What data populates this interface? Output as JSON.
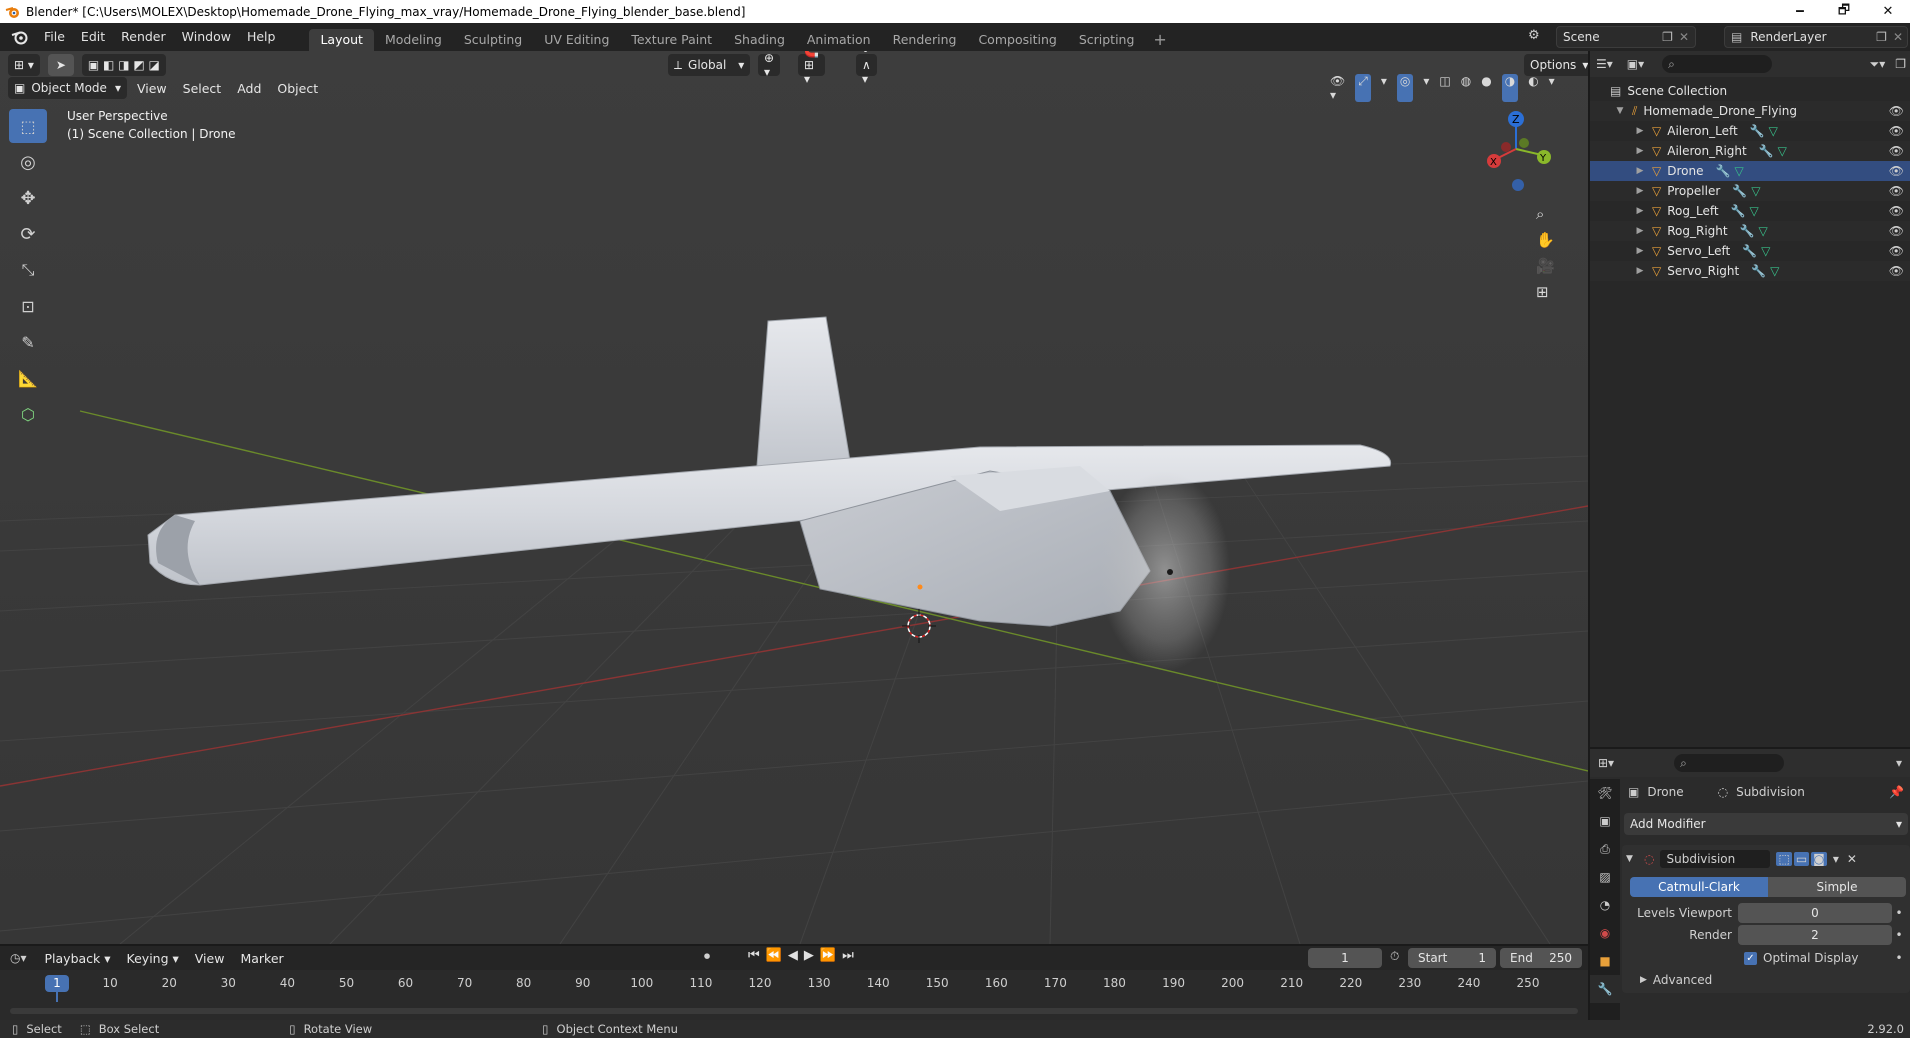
{
  "window": {
    "title": "Blender* [C:\\Users\\MOLEX\\Desktop\\Homemade_Drone_Flying_max_vray/Homemade_Drone_Flying_blender_base.blend]",
    "minimize": "🗕",
    "maximize": "🗗",
    "close": "✕"
  },
  "menu": [
    "File",
    "Edit",
    "Render",
    "Window",
    "Help"
  ],
  "workspaces": [
    "Layout",
    "Modeling",
    "Sculpting",
    "UV Editing",
    "Texture Paint",
    "Shading",
    "Animation",
    "Rendering",
    "Compositing",
    "Scripting"
  ],
  "workspace_add": "+",
  "scene": {
    "name": "Scene",
    "render_layer": "RenderLayer"
  },
  "viewport": {
    "mode": "Object Mode",
    "menus": [
      "View",
      "Select",
      "Add",
      "Object"
    ],
    "orientation": "Global",
    "options": "Options",
    "overlay_line1": "User Perspective",
    "overlay_line2": "(1) Scene Collection | Drone",
    "gizmo": {
      "z": "Z",
      "y": "Y",
      "x": "X"
    }
  },
  "outliner": {
    "root": "Scene Collection",
    "collection": "Homemade_Drone_Flying",
    "objects": [
      "Aileron_Left",
      "Aileron_Right",
      "Drone",
      "Propeller",
      "Rog_Left",
      "Rog_Right",
      "Servo_Left",
      "Servo_Right"
    ]
  },
  "properties": {
    "object": "Drone",
    "modifier_context": "Subdivision",
    "add_modifier": "Add Modifier",
    "modifier_name": "Subdivision",
    "type_catmull": "Catmull-Clark",
    "type_simple": "Simple",
    "levels_viewport_label": "Levels Viewport",
    "levels_viewport_value": "0",
    "render_label": "Render",
    "render_value": "2",
    "optimal_display": "Optimal Display",
    "advanced": "Advanced"
  },
  "timeline": {
    "menus": [
      "Playback",
      "Keying",
      "View",
      "Marker"
    ],
    "current_frame": "1",
    "start_label": "Start",
    "start_value": "1",
    "end_label": "End",
    "end_value": "250",
    "ticks": [
      "1",
      "10",
      "20",
      "30",
      "40",
      "50",
      "60",
      "70",
      "80",
      "90",
      "100",
      "110",
      "120",
      "130",
      "140",
      "150",
      "160",
      "170",
      "180",
      "190",
      "200",
      "210",
      "220",
      "230",
      "240",
      "250"
    ]
  },
  "status": {
    "select": "Select",
    "box_select": "Box Select",
    "rotate_view": "Rotate View",
    "context_menu": "Object Context Menu",
    "version": "2.92.0"
  }
}
